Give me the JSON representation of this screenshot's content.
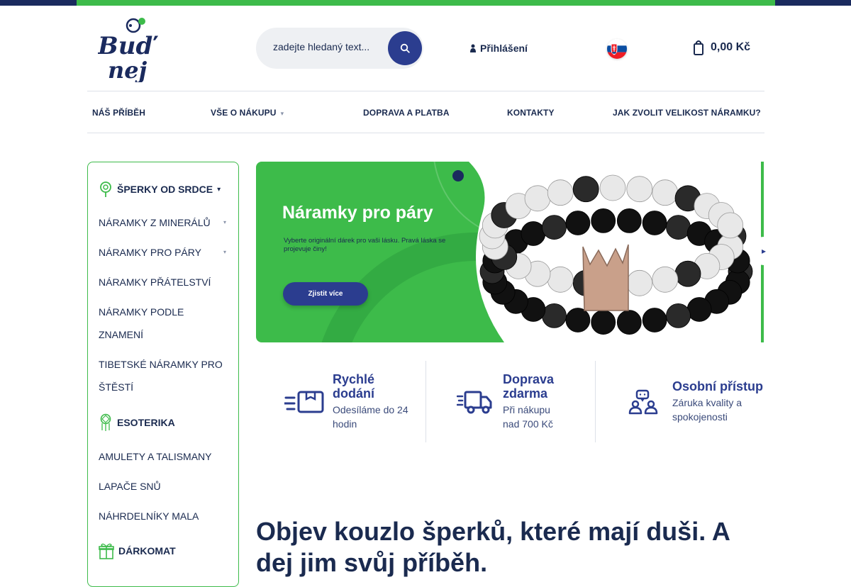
{
  "header": {
    "search_placeholder": "zadejte hledaný text...",
    "login_label": "Přihlášení",
    "cart_total": "0,00 Kč"
  },
  "nav": {
    "items": [
      {
        "label": "NÁŠ PŘÍBĚH"
      },
      {
        "label": "VŠE O NÁKUPU"
      },
      {
        "label": "DOPRAVA A PLATBA"
      },
      {
        "label": "KONTAKTY"
      },
      {
        "label": "JAK ZVOLIT VELIKOST NÁRAMKU?"
      }
    ]
  },
  "sidebar": {
    "categories": [
      {
        "label": "ŠPERKY OD SRDCE",
        "icon": "pendant-icon",
        "items": [
          {
            "label": "NÁRAMKY Z MINERÁLŮ",
            "has_children": true
          },
          {
            "label": "NÁRAMKY PRO PÁRY",
            "has_children": true
          },
          {
            "label": "NÁRAMKY PŘÁTELSTVÍ"
          },
          {
            "label": "NÁRAMKY PODLE ZNAMENÍ"
          },
          {
            "label": "TIBETSKÉ NÁRAMKY PRO ŠTĚSTÍ"
          }
        ]
      },
      {
        "label": "ESOTERIKA",
        "icon": "dreamcatcher-icon",
        "items": [
          {
            "label": "AMULETY A TALISMANY"
          },
          {
            "label": "LAPAČE SNŮ"
          },
          {
            "label": "NÁHRDELNÍKY MALA"
          }
        ]
      },
      {
        "label": "DÁRKOMAT",
        "icon": "gift-icon",
        "items": []
      }
    ]
  },
  "banner": {
    "title": "Náramky pro páry",
    "text": "Vyberte originální dárek pro vaši lásku. Pravá láska se projevuje činy!",
    "button": "Zjistit více"
  },
  "features": [
    {
      "title": "Rychlé dodání",
      "subtitle": "Odesíláme do 24 hodin",
      "icon": "fast-delivery-icon"
    },
    {
      "title": "Doprava zdarma",
      "subtitle": "Při nákupu nad 700 Kč",
      "icon": "truck-icon"
    },
    {
      "title": "Osobní přístup",
      "subtitle": "Záruka kvality a spokojenosti",
      "icon": "support-people-icon"
    }
  ],
  "headline": "Objev kouzlo šperků, které mají duši. A dej jim svůj příběh.",
  "colors": {
    "brand_green": "#3dbb4a",
    "brand_navy": "#1a2a5e",
    "accent_blue": "#2b3d8f"
  }
}
